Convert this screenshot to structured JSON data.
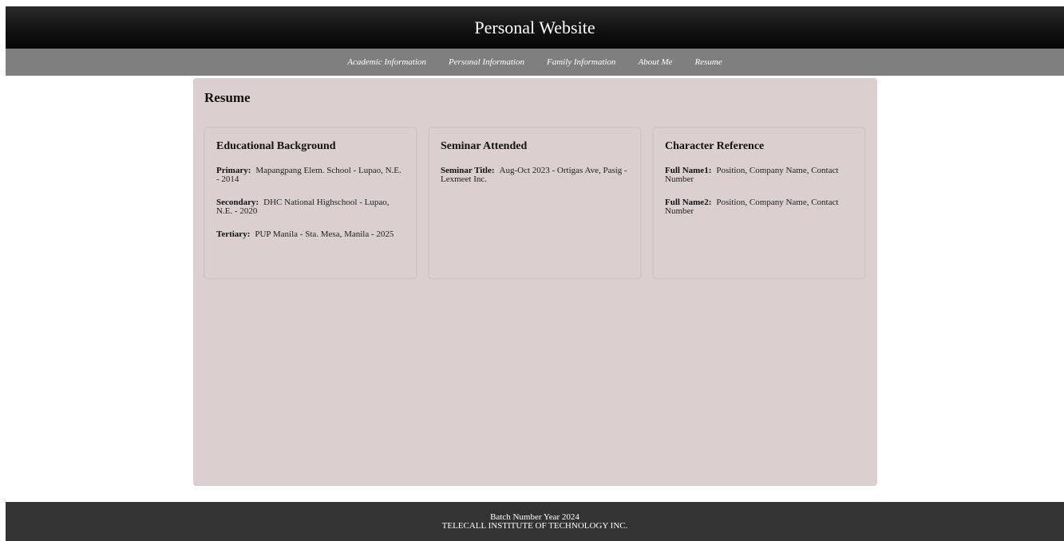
{
  "header": {
    "title": "Personal Website"
  },
  "nav": {
    "items": [
      {
        "label": "Academic Information"
      },
      {
        "label": "Personal Information"
      },
      {
        "label": "Family Information"
      },
      {
        "label": "About Me"
      },
      {
        "label": "Resume"
      }
    ]
  },
  "main": {
    "title": "Resume",
    "cards": [
      {
        "title": "Educational Background",
        "entries": [
          {
            "label": "Primary:",
            "value": "Mapangpang Elem. School - Lupao, N.E. - 2014"
          },
          {
            "label": "Secondary:",
            "value": "DHC National Highschool - Lupao, N.E. - 2020"
          },
          {
            "label": "Tertiary:",
            "value": "PUP Manila - Sta. Mesa, Manila - 2025"
          }
        ]
      },
      {
        "title": "Seminar Attended",
        "entries": [
          {
            "label": "Seminar Title:",
            "value": "Aug-Oct 2023 - Ortigas Ave, Pasig - Lexmeet Inc."
          }
        ]
      },
      {
        "title": "Character Reference",
        "entries": [
          {
            "label": "Full Name1:",
            "value": "Position, Company Name, Contact Number"
          },
          {
            "label": "Full Name2:",
            "value": "Position, Company Name, Contact Number"
          }
        ]
      }
    ]
  },
  "footer": {
    "line1": "Batch Number Year 2024",
    "line2": "TELECALL INSTITUTE OF TECHNOLOGY INC."
  },
  "colors": {
    "header_bg": "#0d0d0d",
    "nav_bg": "#7f7f7f",
    "content_bg": "#dbcfcf",
    "footer_bg": "#333333"
  }
}
